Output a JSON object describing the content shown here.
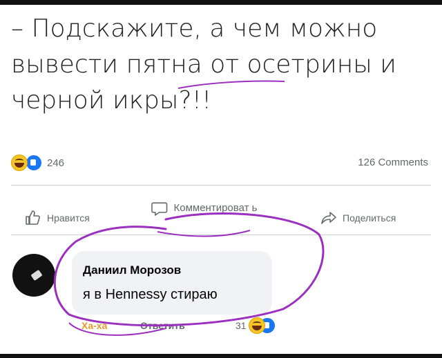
{
  "post": {
    "text": "– Подскажите, а чем можно вывести пятна от осетрины и черной икры?!!"
  },
  "reactions": {
    "count": "246",
    "comments": "126 Comments"
  },
  "actions": {
    "like": "Нравится",
    "comment": "Комментироват ь",
    "share": "Поделиться"
  },
  "comment": {
    "author": "Даниил Морозов",
    "text": "я в Hennessy стираю",
    "haha_label": "Ха-ха",
    "reply_label": "Ответить",
    "reaction_count": "31"
  },
  "colors": {
    "annotation": "#9b2fbf",
    "facebook_blue": "#1877f2",
    "laugh_yellow": "#f7c626"
  },
  "icons": [
    "thumb-up-icon",
    "comment-icon",
    "share-arrow-icon",
    "laugh-emoji-icon",
    "like-emoji-icon"
  ]
}
